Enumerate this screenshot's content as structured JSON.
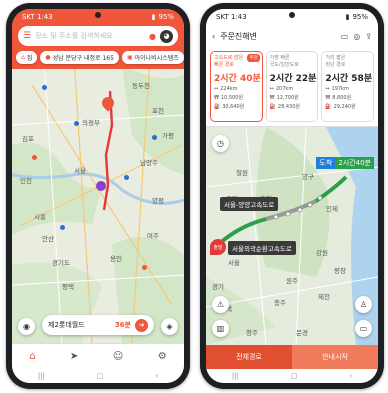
{
  "left_phone": {
    "status": {
      "time": "SKT 1:43",
      "battery": "95%"
    },
    "search": {
      "placeholder": "장소 및 주소를 검색하세요"
    },
    "chips": [
      {
        "label": "집",
        "icon": "home-icon"
      },
      {
        "label": "성남 분당구 내정로 165",
        "icon": "pin-icon"
      },
      {
        "label": "아이나비시스템즈",
        "icon": "building-icon"
      }
    ],
    "map_labels": [
      "동두천",
      "의정부",
      "포천",
      "김포",
      "남양주",
      "서울",
      "양평",
      "인천",
      "가평",
      "시흥",
      "안산",
      "경기도",
      "여주",
      "평택",
      "용인"
    ],
    "destination": {
      "name": "제2롯데월드",
      "time": "36분"
    },
    "nav_icons": [
      "home-icon",
      "navigate-icon",
      "person-icon",
      "settings-icon"
    ]
  },
  "right_phone": {
    "status": {
      "time": "SKT 1:43",
      "battery": "95%"
    },
    "header": {
      "title": "주문진해변"
    },
    "routes": [
      {
        "subtitle": "고속도로 많은\n빠른 경로",
        "badge": "추천",
        "time": "2시간 40분",
        "dist": "224km",
        "toll": "10,500원",
        "fuel": "30,640원"
      },
      {
        "subtitle": "가장 빠른\n국도/일반도로",
        "time": "2시간 22분",
        "dist": "207km",
        "toll": "12,700원",
        "fuel": "28,430원"
      },
      {
        "subtitle": "거리 짧은\n최단 경로",
        "time": "2시간 58분",
        "dist": "197km",
        "toll": "8,600원",
        "fuel": "29,240원"
      }
    ],
    "arrival": {
      "label": "도착",
      "time": "2시간40분"
    },
    "highways": [
      "서울-양양고속도로",
      "서울외곽순환고속도로"
    ],
    "start_label": "출발",
    "map_labels": [
      "철원",
      "포천",
      "춘천",
      "양구",
      "인제",
      "강원",
      "서울",
      "원주",
      "충주",
      "제천",
      "문경",
      "평창",
      "청주",
      "평택",
      "경기"
    ],
    "actions": {
      "all_routes": "전체경로",
      "start_guide": "안내시작"
    }
  }
}
